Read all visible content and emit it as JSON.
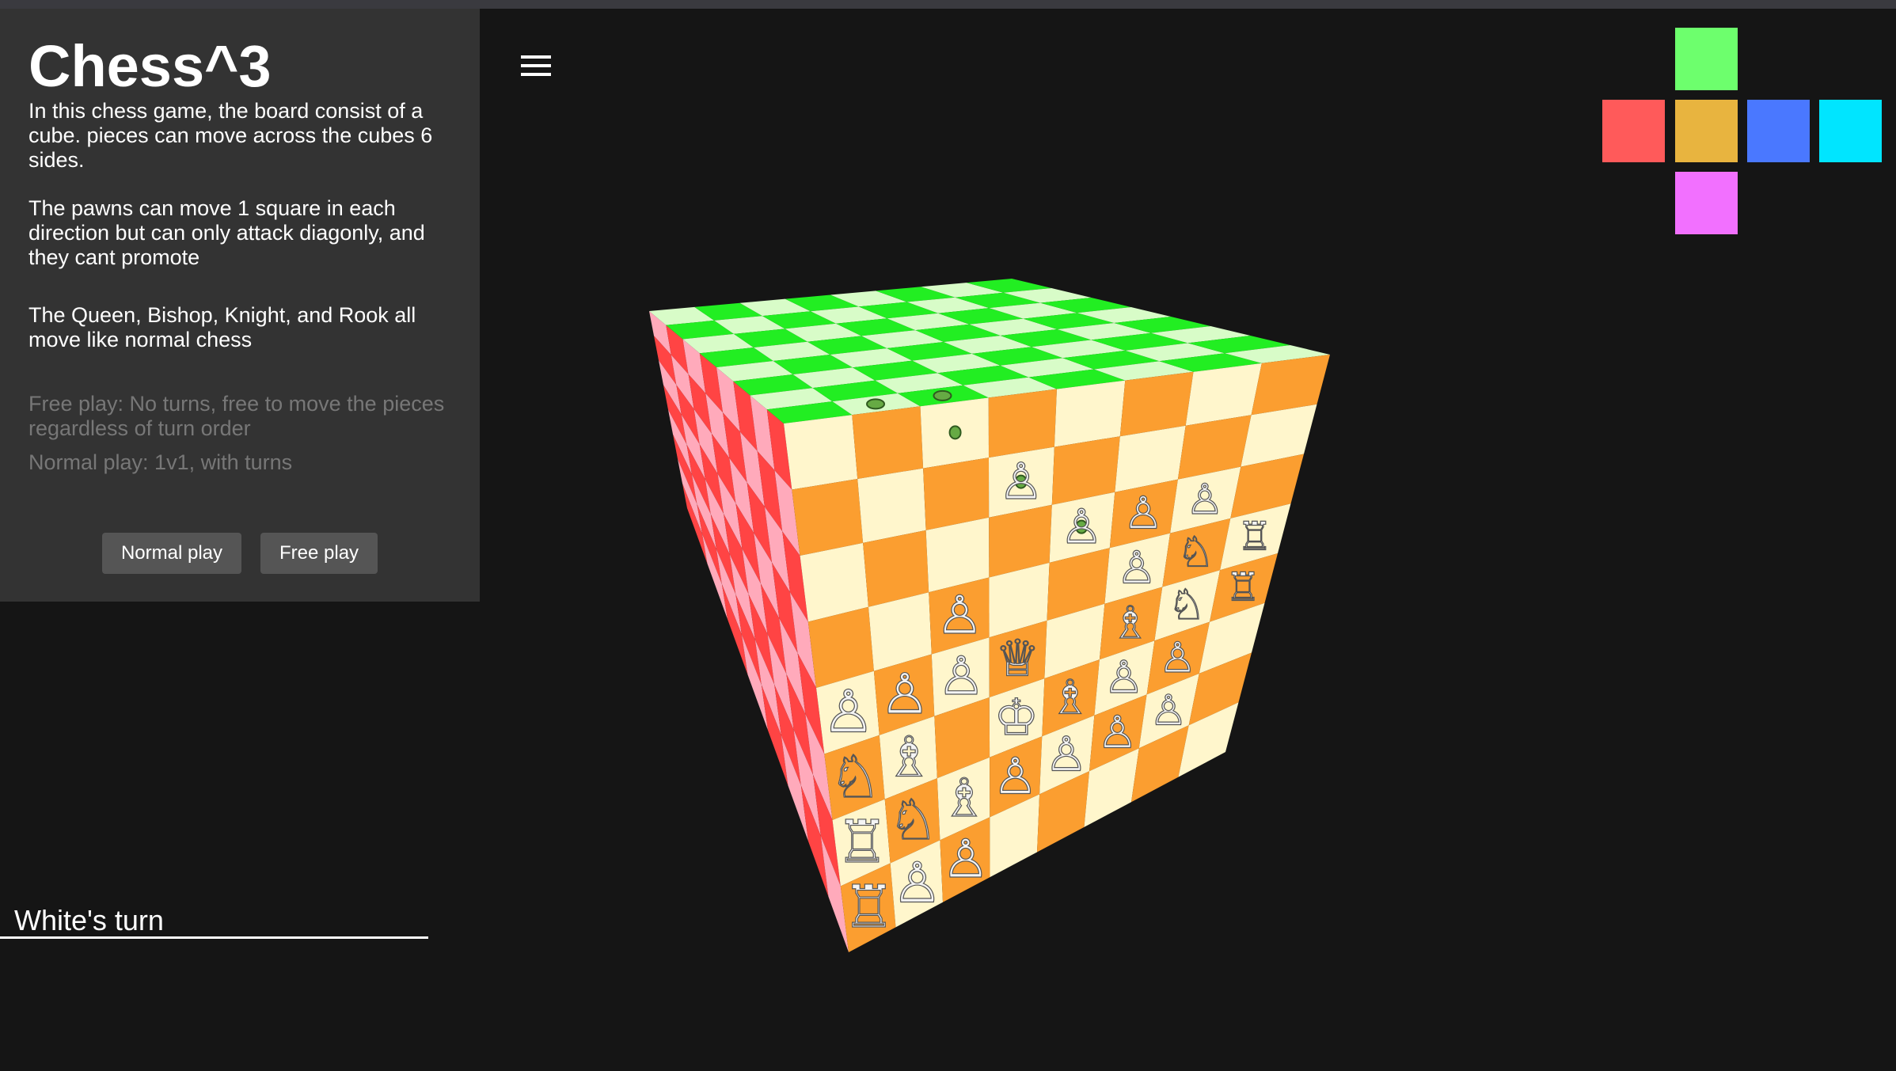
{
  "info": {
    "title": "Chess^3",
    "paragraphs": [
      "In this chess game, the board consist of a cube. pieces can move across the cubes 6 sides.",
      "The pawns can move 1 square in each direction but can only attack diagonly, and they cant promote",
      "The Queen, Bishop, Knight, and Rook all move like normal chess"
    ],
    "modes": [
      "Free play: No turns, free to move the pieces regardless of turn order",
      "Normal play: 1v1, with turns"
    ],
    "buttons": {
      "normal": "Normal play",
      "free": "Free play"
    }
  },
  "status": {
    "turn": "White's turn"
  },
  "icons": {
    "menu": "hamburger-menu-icon"
  },
  "face_picker": [
    {
      "name": "face-top",
      "color": "#6dff6d"
    },
    {
      "name": "face-left",
      "color": "#ff5a5a"
    },
    {
      "name": "face-front",
      "color": "#e8b43f"
    },
    {
      "name": "face-right",
      "color": "#4a78ff"
    },
    {
      "name": "face-back",
      "color": "#00e5ff"
    },
    {
      "name": "face-bottom",
      "color": "#f270ff"
    }
  ],
  "colors": {
    "top_dark": "#22ee22",
    "top_light": "#d8fcc8",
    "front_dark": "#fb9e30",
    "front_light": "#fff6cc",
    "left_dark": "#ff4444",
    "left_light": "#ffaabb"
  },
  "board": {
    "size": 8,
    "front_pieces": [
      [
        "",
        "",
        "",
        "",
        "",
        "",
        "",
        ""
      ],
      [
        "",
        "",
        "",
        "pawn",
        "",
        "",
        "",
        ""
      ],
      [
        "",
        "",
        "",
        "",
        "pawn",
        "pawn",
        "pawn",
        ""
      ],
      [
        "",
        "",
        "pawn",
        "",
        "",
        "pawn",
        "knight",
        "rook"
      ],
      [
        "pawn",
        "pawn",
        "pawn",
        "queen",
        "",
        "bishop",
        "knight",
        "rook"
      ],
      [
        "knight",
        "bishop",
        "",
        "king",
        "bishop",
        "pawn",
        "pawn",
        ""
      ],
      [
        "rook",
        "knight",
        "bishop",
        "pawn",
        "pawn",
        "pawn",
        "pawn",
        ""
      ],
      [
        "rook",
        "pawn",
        "pawn",
        "",
        "",
        "",
        "",
        ""
      ]
    ],
    "front_move_dots": [
      [
        0,
        1
      ],
      [
        1,
        2
      ],
      [
        2,
        3
      ]
    ],
    "top_move_dots": [
      [
        0,
        1
      ],
      [
        0,
        2
      ]
    ]
  }
}
